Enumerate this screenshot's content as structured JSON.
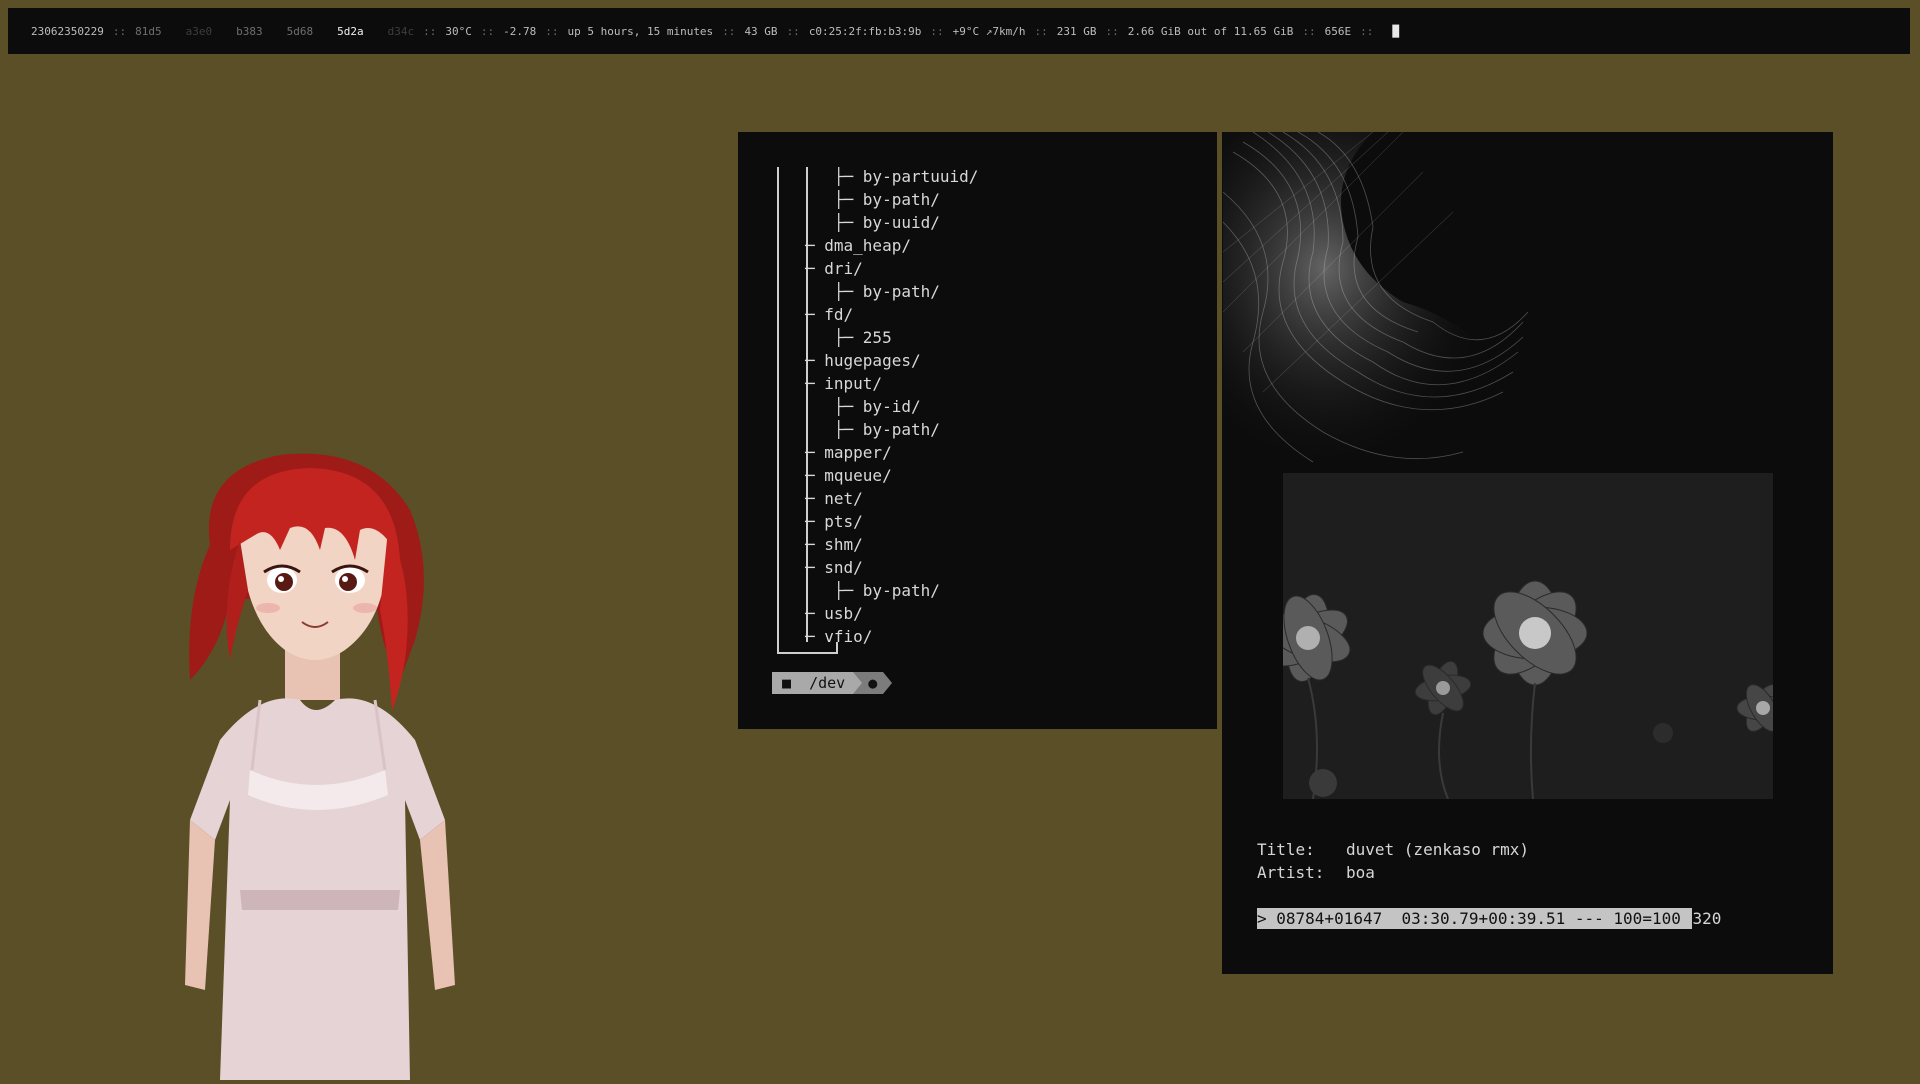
{
  "bar": {
    "date": "23062350229",
    "separator": "::",
    "workspaces": [
      {
        "label": "81d5",
        "state": "dim"
      },
      {
        "label": "a3e0",
        "state": "dimmer"
      },
      {
        "label": "b383",
        "state": "dim"
      },
      {
        "label": "5d68",
        "state": "dim"
      },
      {
        "label": "5d2a",
        "state": "active"
      },
      {
        "label": "d34c",
        "state": "dimmer"
      }
    ],
    "temperature": "30°C",
    "value": "-2.78",
    "uptime": "up 5 hours, 15 minutes",
    "disk1": "43 GB",
    "mac": "c0:25:2f:fb:b3:9b",
    "weather": "+9°C ↗7km/h",
    "disk2": "231 GB",
    "memory": "2.66 GiB out of 11.65 GiB",
    "extra": "656E",
    "cursor": "█"
  },
  "tree": {
    "items": [
      {
        "prefix": "   ├─ ",
        "name": "by-partuuid/"
      },
      {
        "prefix": "   ├─ ",
        "name": "by-path/"
      },
      {
        "prefix": "   ├─ ",
        "name": "by-uuid/"
      },
      {
        "prefix": "─ ",
        "name": "dma_heap/"
      },
      {
        "prefix": "─ ",
        "name": "dri/"
      },
      {
        "prefix": "   ├─ ",
        "name": "by-path/"
      },
      {
        "prefix": "─ ",
        "name": "fd/"
      },
      {
        "prefix": "   ├─ ",
        "name": "255"
      },
      {
        "prefix": "─ ",
        "name": "hugepages/"
      },
      {
        "prefix": "─ ",
        "name": "input/"
      },
      {
        "prefix": "   ├─ ",
        "name": "by-id/"
      },
      {
        "prefix": "   ├─ ",
        "name": "by-path/"
      },
      {
        "prefix": "─ ",
        "name": "mapper/"
      },
      {
        "prefix": "─ ",
        "name": "mqueue/"
      },
      {
        "prefix": "─ ",
        "name": "net/"
      },
      {
        "prefix": "─ ",
        "name": "pts/"
      },
      {
        "prefix": "─ ",
        "name": "shm/"
      },
      {
        "prefix": "─ ",
        "name": "snd/"
      },
      {
        "prefix": "   ├─ ",
        "name": "by-path/"
      },
      {
        "prefix": "─ ",
        "name": "usb/"
      },
      {
        "prefix": "─ ",
        "name": "vfio/"
      }
    ],
    "prompt_icon": "■",
    "prompt_path": "/dev",
    "prompt_status": "●"
  },
  "music": {
    "title_key": "Title:",
    "title": "duvet (zenkaso rmx)",
    "artist_key": "Artist:",
    "artist": "boa",
    "progress_filled": "> 08784+01647  03:30.79+00:39.51 --- 100=100 ",
    "progress_rest": "320"
  },
  "colors": {
    "wallpaper": "#5b4f27",
    "panel": "#0c0c0c",
    "hair": "#c4241f"
  }
}
